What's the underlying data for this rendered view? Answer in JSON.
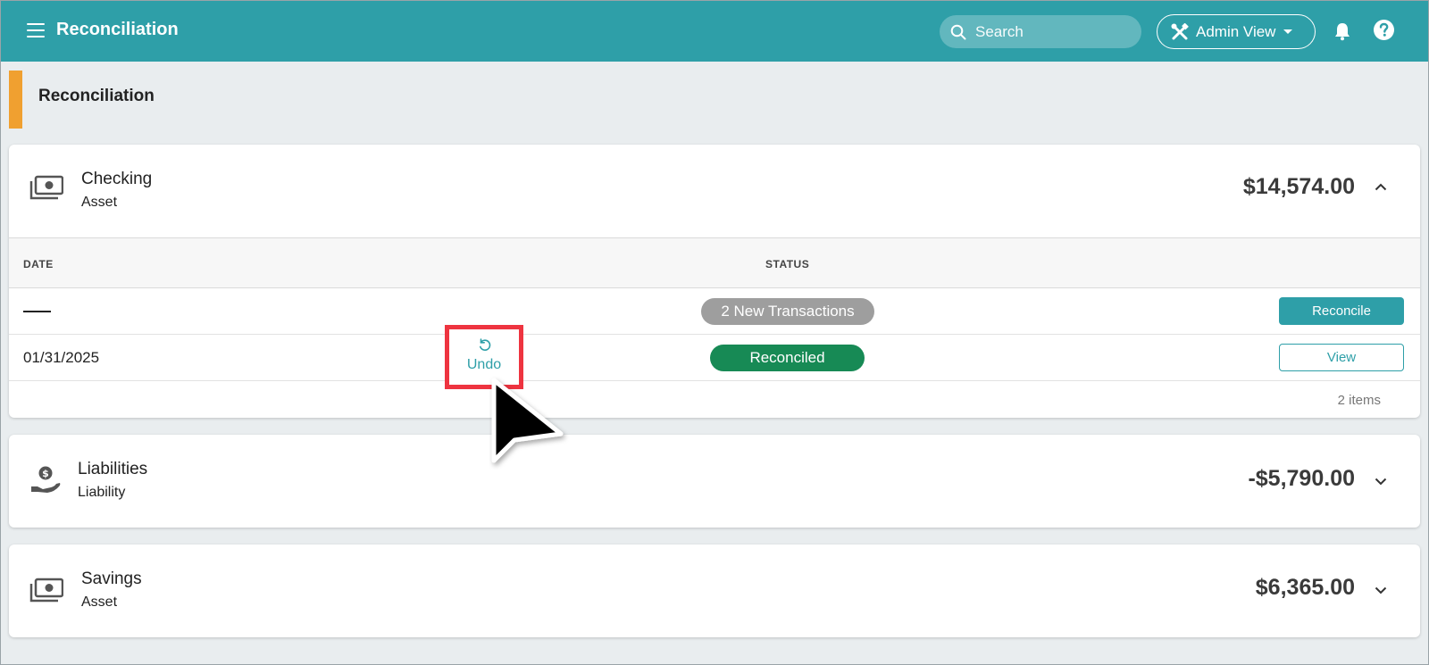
{
  "topbar": {
    "title": "Reconciliation",
    "search_placeholder": "Search",
    "admin_view_label": "Admin View",
    "accent_color": "#2e9fa8"
  },
  "page": {
    "title": "Reconciliation",
    "accent_color": "#f0a030"
  },
  "accounts": [
    {
      "name": "Checking",
      "type": "Asset",
      "amount": "$14,574.00",
      "icon": "money-icon",
      "expanded": true,
      "table": {
        "columns": [
          "DATE",
          "STATUS"
        ],
        "rows": [
          {
            "date": "",
            "status": "2 New Transactions",
            "action": "Reconcile"
          },
          {
            "date": "01/31/2025",
            "undo_label": "Undo",
            "status": "Reconciled",
            "action": "View"
          }
        ],
        "footer": "2 items"
      }
    },
    {
      "name": "Liabilities",
      "type": "Liability",
      "amount": "-$5,790.00",
      "icon": "hand-coin-icon",
      "expanded": false
    },
    {
      "name": "Savings",
      "type": "Asset",
      "amount": "$6,365.00",
      "icon": "money-icon",
      "expanded": false
    }
  ],
  "colors": {
    "reconciled_green": "#178a55",
    "new_gray": "#9e9e9e",
    "highlight_red": "#ee3440"
  }
}
